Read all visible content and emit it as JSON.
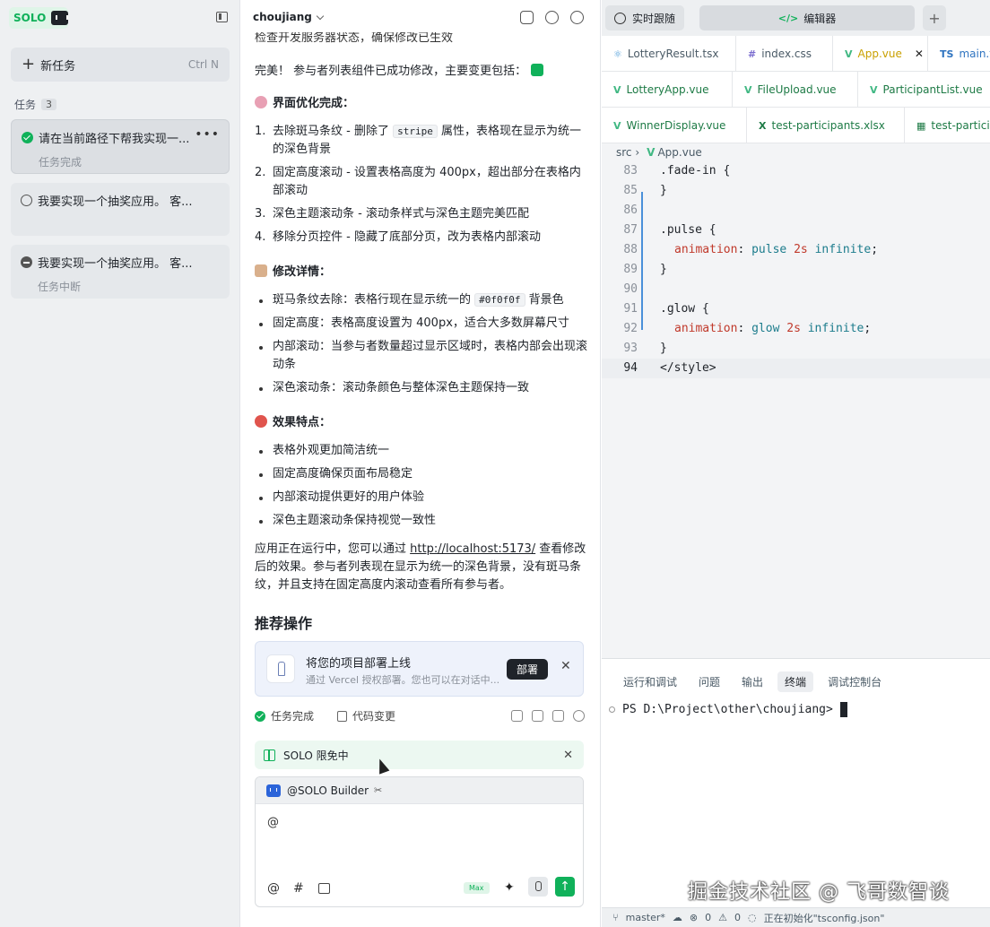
{
  "left": {
    "logo": "SOLO",
    "new_task": "新任务",
    "new_task_kbd": "Ctrl N",
    "tasks_header": "任务",
    "tasks_count": "3",
    "tasks": [
      {
        "title": "请在当前路径下帮我实现一...",
        "status": "任务完成"
      },
      {
        "title": "我要实现一个抽奖应用。 客...",
        "status": ""
      },
      {
        "title": "我要实现一个抽奖应用。 客...",
        "status": "任务中断"
      }
    ]
  },
  "mid": {
    "project": "choujiang",
    "top_line": "检查开发服务器状态，确保修改已生效",
    "summary": "完美！ 参与者列表组件已成功修改，主要变更包括：",
    "sec1": "界面优化完成：",
    "ol": [
      {
        "n": "1.",
        "a": "去除斑马条纹 - 删除了 ",
        "code": "stripe",
        "b": " 属性，表格现在显示为统一的深色背景"
      },
      {
        "n": "2.",
        "a": "固定高度滚动 - 设置表格高度为 400px，超出部分在表格内部滚动"
      },
      {
        "n": "3.",
        "a": "深色主题滚动条 - 滚动条样式与深色主题完美匹配"
      },
      {
        "n": "4.",
        "a": "移除分页控件 - 隐藏了底部分页，改为表格内部滚动"
      }
    ],
    "sec2": "修改详情：",
    "ul1": [
      {
        "a": "斑马条纹去除：表格行现在显示统一的 ",
        "code": "#0f0f0f",
        "b": " 背景色"
      },
      {
        "a": "固定高度：表格高度设置为 400px，适合大多数屏幕尺寸"
      },
      {
        "a": "内部滚动：当参与者数量超过显示区域时，表格内部会出现滚动条"
      },
      {
        "a": "深色滚动条：滚动条颜色与整体深色主题保持一致"
      }
    ],
    "sec3": "效果特点：",
    "ul2": [
      "表格外观更加简洁统一",
      "固定高度确保页面布局稳定",
      "内部滚动提供更好的用户体验",
      "深色主题滚动条保持视觉一致性"
    ],
    "para_a": "应用正在运行中，您可以通过 ",
    "para_link": "http://localhost:5173/",
    "para_b": " 查看修改后的效果。参与者列表现在显示为统一的深色背景，没有斑马条纹，并且支持在固定高度内滚动查看所有参与者。",
    "recommend": "推荐操作",
    "card_title": "将您的项目部署上线",
    "card_sub": "通过 Vercel 授权部署。您也可以在对话中...",
    "deploy": "部署",
    "status_done": "任务完成",
    "status_diff": "代码变更",
    "promo": "SOLO 限免中",
    "builder": "@SOLO Builder",
    "input_text": "@",
    "max": "Max"
  },
  "right": {
    "btn_follow": "实时跟随",
    "btn_editor": "编辑器",
    "btn_add": "+",
    "tabs_row1": [
      {
        "icon": "react",
        "name": "LotteryResult.tsx"
      },
      {
        "icon": "hash",
        "name": "index.css"
      },
      {
        "icon": "vue",
        "name": "App.vue"
      },
      {
        "icon": "ts",
        "name": "main.ts"
      }
    ],
    "tabs_row2": [
      {
        "icon": "vue",
        "name": "LotteryApp.vue"
      },
      {
        "icon": "vue",
        "name": "FileUpload.vue"
      },
      {
        "icon": "vue",
        "name": "ParticipantList.vue"
      }
    ],
    "tabs_row3": [
      {
        "icon": "vue",
        "name": "WinnerDisplay.vue"
      },
      {
        "icon": "xlsx",
        "name": "test-participants.xlsx"
      },
      {
        "icon": "table",
        "name": "test-participants"
      }
    ],
    "crumb_root": "src",
    "crumb_file": "App.vue",
    "lines": [
      {
        "no": "83",
        "a": ".fade-in {"
      },
      {
        "no": "85",
        "a": "}"
      },
      {
        "no": "86",
        "a": ""
      },
      {
        "no": "87",
        "a": ".pulse {"
      },
      {
        "no": "88",
        "k": "animation",
        "n": "pulse",
        "v": "2s",
        "w": "infinite"
      },
      {
        "no": "89",
        "a": "}"
      },
      {
        "no": "90",
        "a": ""
      },
      {
        "no": "91",
        "a": ".glow {"
      },
      {
        "no": "92",
        "k": "animation",
        "n": "glow",
        "v": "2s",
        "w": "infinite"
      },
      {
        "no": "93",
        "a": "}"
      },
      {
        "no": "94",
        "t": "</style>"
      }
    ],
    "panel_tabs": [
      "运行和调试",
      "问题",
      "输出",
      "终端",
      "调试控制台"
    ],
    "terminal": "PS D:\\Project\\other\\choujiang>",
    "watermark": "掘金技术社区 @ 飞哥数智谈",
    "statusbar": {
      "branch": "master*",
      "errors": "0",
      "warnings": "0",
      "task": "正在初始化\"tsconfig.json\""
    }
  }
}
